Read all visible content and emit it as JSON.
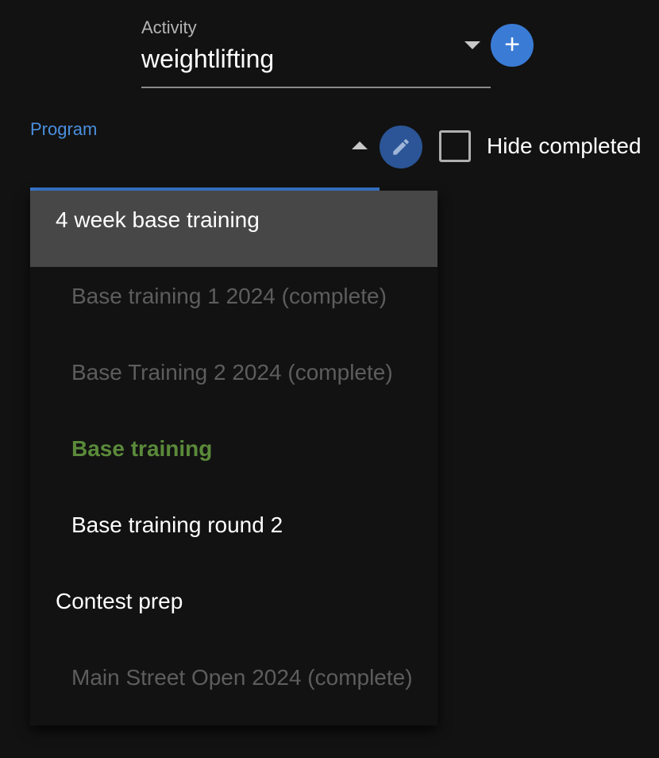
{
  "activity": {
    "label": "Activity",
    "value": "weightlifting",
    "caret_icon": "caret-down-icon",
    "add_icon": "plus-icon",
    "add_symbol": "+",
    "accent_color": "#3a7bd5"
  },
  "program": {
    "label": "Program",
    "caret_icon": "caret-up-icon",
    "edit_icon": "pencil-icon",
    "label_color": "#4a8fdd"
  },
  "hide_completed": {
    "label": "Hide completed",
    "checked": false
  },
  "menu": {
    "items": [
      {
        "label": "4 week base training",
        "level": "top",
        "state": "highlighted"
      },
      {
        "label": "Base training 1 2024 (complete)",
        "level": "nested",
        "state": "complete"
      },
      {
        "label": "Base Training 2 2024 (complete)",
        "level": "nested",
        "state": "complete"
      },
      {
        "label": "Base training",
        "level": "nested",
        "state": "active"
      },
      {
        "label": "Base training round 2",
        "level": "nested",
        "state": "normal"
      },
      {
        "label": "Contest prep",
        "level": "top",
        "state": "normal"
      },
      {
        "label": "Main Street Open 2024 (complete)",
        "level": "nested",
        "state": "complete"
      }
    ],
    "colors": {
      "highlight_bg": "#474747",
      "complete_text": "#5d5d5d",
      "active_text": "#5a8a3a"
    }
  }
}
